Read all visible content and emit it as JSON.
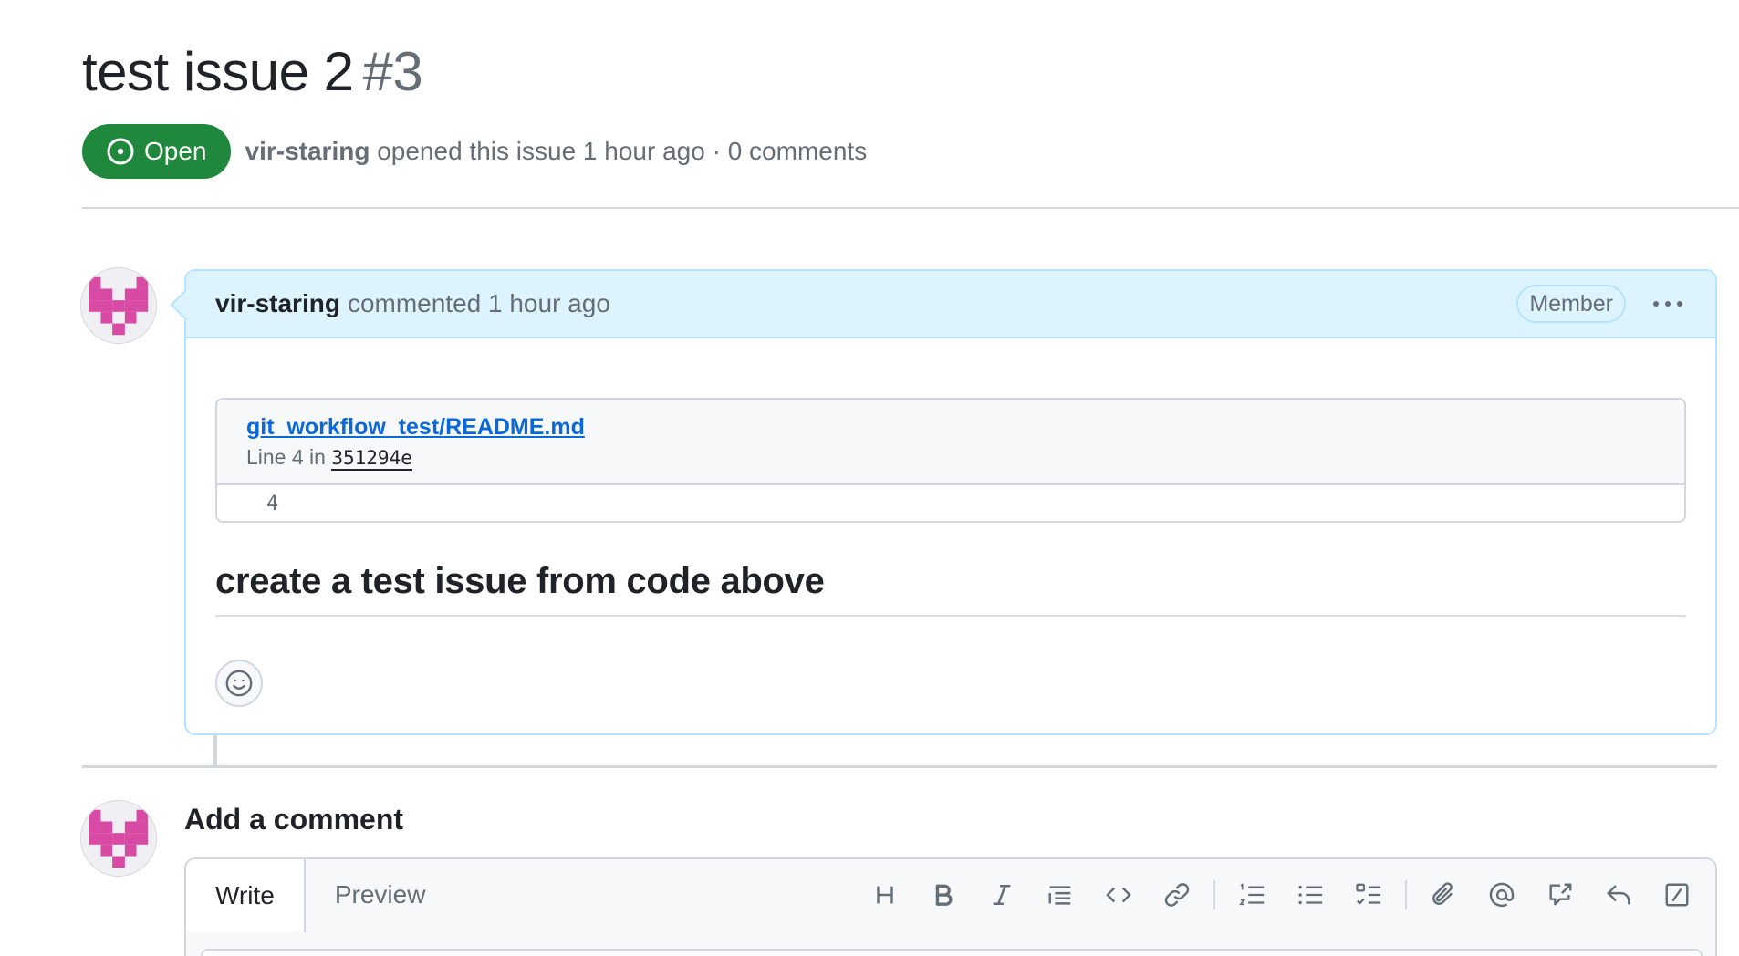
{
  "issue": {
    "title": "test issue 2",
    "number": "#3",
    "state": "Open",
    "author": "vir-staring",
    "opened_text": "opened this issue 1 hour ago · 0 comments"
  },
  "comment": {
    "author": "vir-staring",
    "action": "commented 1 hour ago",
    "badge": "Member",
    "snippet": {
      "file": "git_workflow_test/README.md",
      "line_prefix": "Line 4 in",
      "sha": "351294e",
      "line_number": "4"
    },
    "body_heading": "create a test issue from code above"
  },
  "add_comment": {
    "title": "Add a comment",
    "tabs": [
      "Write",
      "Preview"
    ]
  },
  "toolbar": {
    "items": [
      "heading-icon",
      "bold-icon",
      "italic-icon",
      "quote-icon",
      "code-icon",
      "link-icon",
      "ordered-list-icon",
      "unordered-list-icon",
      "task-list-icon",
      "attach-icon",
      "mention-icon",
      "cross-reference-icon",
      "saved-reply-icon",
      "slash-command-icon"
    ]
  },
  "colors": {
    "open_green": "#1f883d",
    "header_blue": "#ddf4ff",
    "border_blue": "#b6e3ff",
    "link": "#0969da",
    "avatar_pink": "#d94aa5"
  }
}
